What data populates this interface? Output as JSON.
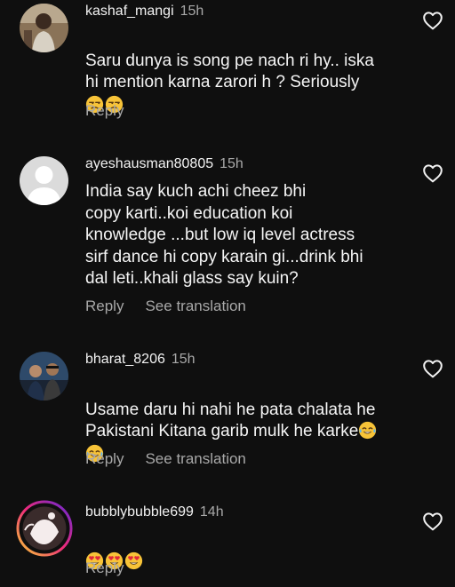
{
  "comments": [
    {
      "username": "kashaf_mangi",
      "time": "15h",
      "text": "Saru dunya is song pe nach ri hy.. iska\nhi mention karna zarori h ? Seriously",
      "emojis": [
        "unamused-face",
        "unamused-face"
      ],
      "reply_label": "Reply",
      "avatar": "photo"
    },
    {
      "username": "ayeshausman80805",
      "time": "15h",
      "text": "India say kuch achi cheez bhi\ncopy karti..koi education koi\nknowledge ...but low iq level actress\nsirf dance hi copy karain gi...drink bhi\ndal leti..khali glass say kuin?",
      "reply_label": "Reply",
      "translation_label": "See translation",
      "avatar": "default"
    },
    {
      "username": "bharat_8206",
      "time": "15h",
      "text": "Usame daru hi nahi he pata chalata he\nPakistani Kitana garib mulk he karke",
      "emojis_inline": [
        "tears-of-joy-face"
      ],
      "emojis": [
        "tears-of-joy-face"
      ],
      "reply_label": "Reply",
      "translation_label": "See translation",
      "avatar": "photo"
    },
    {
      "username": "bubblybubble699",
      "time": "14h",
      "text": "",
      "emojis": [
        "heart-eyes-face",
        "heart-eyes-face",
        "heart-eyes-face"
      ],
      "reply_label": "Reply",
      "avatar": "story-ring"
    }
  ],
  "icons": {
    "like": "heart-outline-icon"
  },
  "colors": {
    "background": "#0f0f0f",
    "primary_text": "#f5f5f5",
    "secondary_text": "#a8a8a8"
  }
}
